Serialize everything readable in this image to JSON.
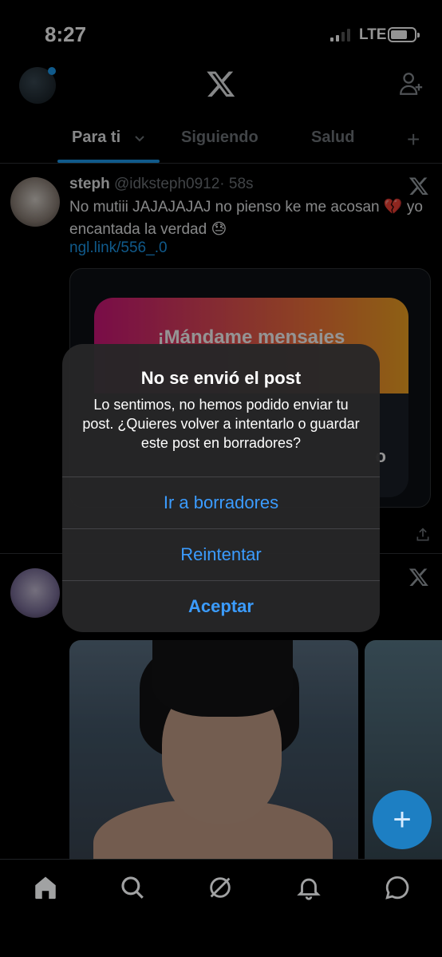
{
  "status_bar": {
    "time": "8:27",
    "network": "LTE"
  },
  "header": {
    "logo": "x-logo-icon"
  },
  "tabs": [
    {
      "label": "Para ti"
    },
    {
      "label": "Siguiendo"
    },
    {
      "label": "Salud"
    }
  ],
  "post1": {
    "author": "steph",
    "handle": "@idksteph0912",
    "time": "· 58s",
    "text": "No mutiii JAJAJAJAJ no pienso ke me acosan 💔 yo encantada la verdad 😓",
    "link": "ngl.link/556_.0",
    "card_title": "¡Mándame mensajes",
    "card_fragment": "o"
  },
  "dialog": {
    "title": "No se envió el post",
    "message": "Lo sentimos, no hemos podido enviar tu post. ¿Quieres volver a intentarlo o guardar este post en borradores?",
    "buttons": {
      "drafts": "Ir a borradores",
      "retry": "Reintentar",
      "accept": "Aceptar"
    }
  },
  "fab": {
    "label": "+"
  },
  "colors": {
    "accent": "#1d9bf0",
    "dialog_button": "#3b9cff",
    "background": "#000000"
  }
}
